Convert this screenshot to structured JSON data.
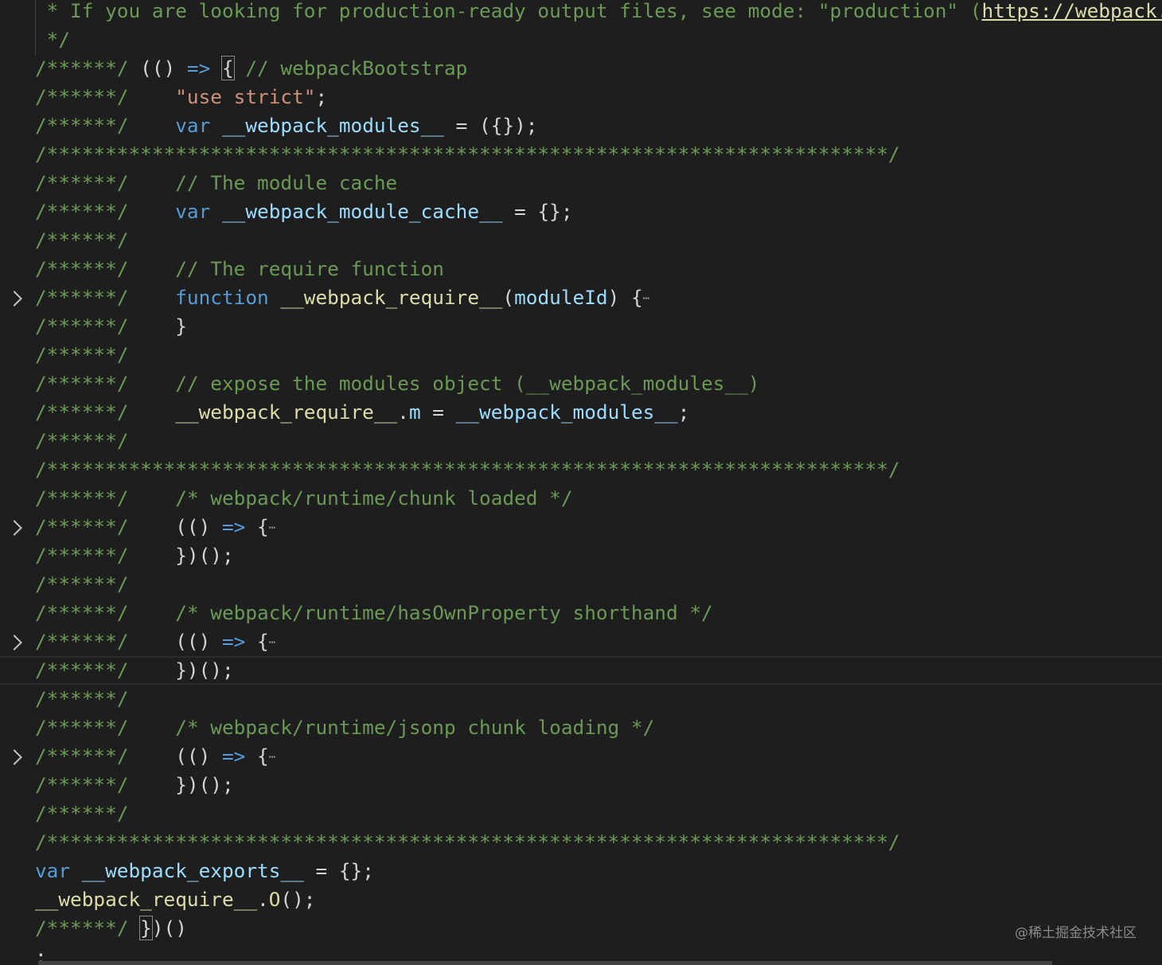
{
  "editor": {
    "lines": [
      {
        "fold": false,
        "current": false,
        "tokens": [
          [
            "cm",
            " * If you are looking for production-ready output files, see mode: \"production\" ("
          ],
          [
            "lk",
            "https://webpack.js.org/configuration/mode/"
          ]
        ]
      },
      {
        "fold": false,
        "current": false,
        "tokens": [
          [
            "cm",
            " */"
          ]
        ]
      },
      {
        "fold": false,
        "current": false,
        "tokens": [
          [
            "cm",
            "/******/"
          ],
          [
            "pn",
            " (() "
          ],
          [
            "kw",
            "=>"
          ],
          [
            "pn",
            " "
          ],
          [
            "br",
            "{"
          ],
          [
            "pn",
            " "
          ],
          [
            "cm",
            "// webpackBootstrap"
          ]
        ]
      },
      {
        "fold": false,
        "current": false,
        "tokens": [
          [
            "cm",
            "/******/"
          ],
          [
            "pn",
            " \t"
          ],
          [
            "st",
            "\"use strict\""
          ],
          [
            "pn",
            ";"
          ]
        ]
      },
      {
        "fold": false,
        "current": false,
        "tokens": [
          [
            "cm",
            "/******/"
          ],
          [
            "pn",
            " \t"
          ],
          [
            "kw",
            "var"
          ],
          [
            "pn",
            " "
          ],
          [
            "vr",
            "__webpack_modules__"
          ],
          [
            "pn",
            " = ({});"
          ]
        ]
      },
      {
        "fold": false,
        "current": false,
        "tokens": [
          [
            "cm",
            "/************************************************************************/"
          ]
        ]
      },
      {
        "fold": false,
        "current": false,
        "tokens": [
          [
            "cm",
            "/******/"
          ],
          [
            "pn",
            " \t"
          ],
          [
            "cm",
            "// The module cache"
          ]
        ]
      },
      {
        "fold": false,
        "current": false,
        "tokens": [
          [
            "cm",
            "/******/"
          ],
          [
            "pn",
            " \t"
          ],
          [
            "kw",
            "var"
          ],
          [
            "pn",
            " "
          ],
          [
            "vr",
            "__webpack_module_cache__"
          ],
          [
            "pn",
            " = {};"
          ]
        ]
      },
      {
        "fold": false,
        "current": false,
        "tokens": [
          [
            "cm",
            "/******/"
          ]
        ]
      },
      {
        "fold": false,
        "current": false,
        "tokens": [
          [
            "cm",
            "/******/"
          ],
          [
            "pn",
            " \t"
          ],
          [
            "cm",
            "// The require function"
          ]
        ]
      },
      {
        "fold": true,
        "current": false,
        "tokens": [
          [
            "cm",
            "/******/"
          ],
          [
            "pn",
            " \t"
          ],
          [
            "kw",
            "function"
          ],
          [
            "pn",
            " "
          ],
          [
            "fn",
            "__webpack_require__"
          ],
          [
            "pn",
            "("
          ],
          [
            "vr",
            "moduleId"
          ],
          [
            "pn",
            ") {"
          ],
          [
            "ellipsis",
            "⋯"
          ]
        ]
      },
      {
        "fold": false,
        "current": false,
        "tokens": [
          [
            "cm",
            "/******/"
          ],
          [
            "pn",
            " \t}"
          ]
        ]
      },
      {
        "fold": false,
        "current": false,
        "tokens": [
          [
            "cm",
            "/******/"
          ]
        ]
      },
      {
        "fold": false,
        "current": false,
        "tokens": [
          [
            "cm",
            "/******/"
          ],
          [
            "pn",
            " \t"
          ],
          [
            "cm",
            "// expose the modules object (__webpack_modules__)"
          ]
        ]
      },
      {
        "fold": false,
        "current": false,
        "tokens": [
          [
            "cm",
            "/******/"
          ],
          [
            "pn",
            " \t"
          ],
          [
            "fn",
            "__webpack_require__"
          ],
          [
            "pn",
            "."
          ],
          [
            "vr",
            "m"
          ],
          [
            "pn",
            " = "
          ],
          [
            "vr",
            "__webpack_modules__"
          ],
          [
            "pn",
            ";"
          ]
        ]
      },
      {
        "fold": false,
        "current": false,
        "tokens": [
          [
            "cm",
            "/******/"
          ]
        ]
      },
      {
        "fold": false,
        "current": false,
        "tokens": [
          [
            "cm",
            "/************************************************************************/"
          ]
        ]
      },
      {
        "fold": false,
        "current": false,
        "tokens": [
          [
            "cm",
            "/******/"
          ],
          [
            "pn",
            " \t"
          ],
          [
            "cm",
            "/* webpack/runtime/chunk loaded */"
          ]
        ]
      },
      {
        "fold": true,
        "current": false,
        "tokens": [
          [
            "cm",
            "/******/"
          ],
          [
            "pn",
            " \t(() "
          ],
          [
            "kw",
            "=>"
          ],
          [
            "pn",
            " {"
          ],
          [
            "ellipsis",
            "⋯"
          ]
        ]
      },
      {
        "fold": false,
        "current": false,
        "tokens": [
          [
            "cm",
            "/******/"
          ],
          [
            "pn",
            " \t})();"
          ]
        ]
      },
      {
        "fold": false,
        "current": false,
        "tokens": [
          [
            "cm",
            "/******/"
          ]
        ]
      },
      {
        "fold": false,
        "current": false,
        "tokens": [
          [
            "cm",
            "/******/"
          ],
          [
            "pn",
            " \t"
          ],
          [
            "cm",
            "/* webpack/runtime/hasOwnProperty shorthand */"
          ]
        ]
      },
      {
        "fold": true,
        "current": false,
        "tokens": [
          [
            "cm",
            "/******/"
          ],
          [
            "pn",
            " \t(() "
          ],
          [
            "kw",
            "=>"
          ],
          [
            "pn",
            " {"
          ],
          [
            "ellipsis",
            "⋯"
          ]
        ]
      },
      {
        "fold": false,
        "current": true,
        "tokens": [
          [
            "cm",
            "/******/"
          ],
          [
            "pn",
            " \t})();"
          ]
        ]
      },
      {
        "fold": false,
        "current": false,
        "tokens": [
          [
            "cm",
            "/******/"
          ]
        ]
      },
      {
        "fold": false,
        "current": false,
        "tokens": [
          [
            "cm",
            "/******/"
          ],
          [
            "pn",
            " \t"
          ],
          [
            "cm",
            "/* webpack/runtime/jsonp chunk loading */"
          ]
        ]
      },
      {
        "fold": true,
        "current": false,
        "tokens": [
          [
            "cm",
            "/******/"
          ],
          [
            "pn",
            " \t(() "
          ],
          [
            "kw",
            "=>"
          ],
          [
            "pn",
            " {"
          ],
          [
            "ellipsis",
            "⋯"
          ]
        ]
      },
      {
        "fold": false,
        "current": false,
        "tokens": [
          [
            "cm",
            "/******/"
          ],
          [
            "pn",
            " \t})();"
          ]
        ]
      },
      {
        "fold": false,
        "current": false,
        "tokens": [
          [
            "cm",
            "/******/"
          ]
        ]
      },
      {
        "fold": false,
        "current": false,
        "tokens": [
          [
            "cm",
            "/************************************************************************/"
          ]
        ]
      },
      {
        "fold": false,
        "current": false,
        "tokens": [
          [
            "kw",
            "var"
          ],
          [
            "pn",
            " "
          ],
          [
            "vr",
            "__webpack_exports__"
          ],
          [
            "pn",
            " = {};"
          ]
        ]
      },
      {
        "fold": false,
        "current": false,
        "tokens": [
          [
            "fn",
            "__webpack_require__"
          ],
          [
            "pn",
            "."
          ],
          [
            "fn",
            "O"
          ],
          [
            "pn",
            "();"
          ]
        ]
      },
      {
        "fold": false,
        "current": false,
        "tokens": [
          [
            "cm",
            "/******/"
          ],
          [
            "pn",
            " "
          ],
          [
            "br",
            "}"
          ],
          [
            "pn",
            ")()"
          ]
        ]
      },
      {
        "fold": false,
        "current": false,
        "tokens": [
          [
            "pn",
            ";"
          ]
        ]
      }
    ]
  },
  "watermark": "@稀土掘金技术社区"
}
